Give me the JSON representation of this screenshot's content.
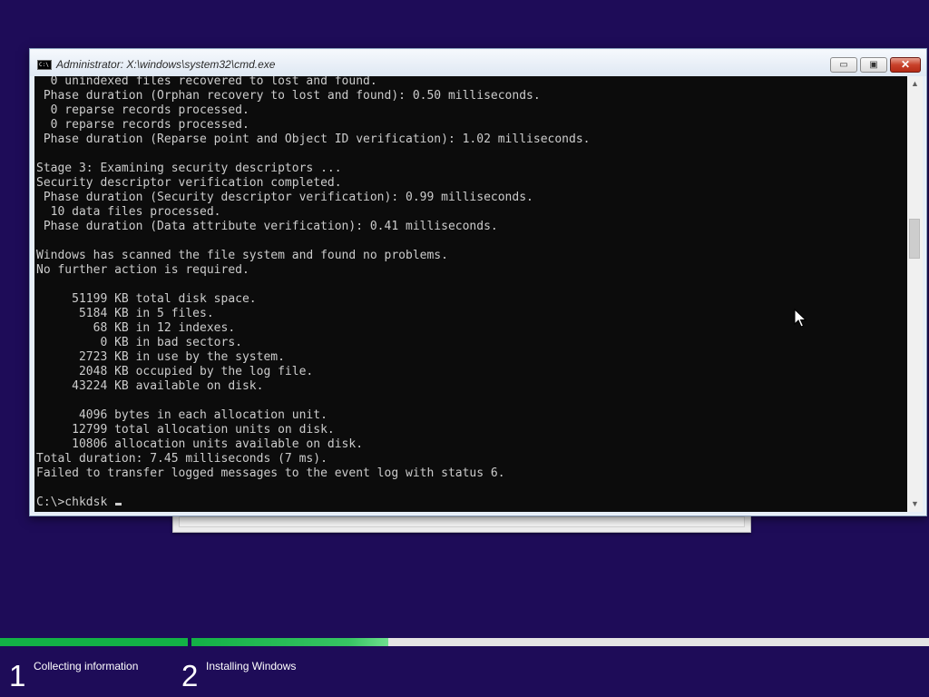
{
  "window": {
    "title": "Administrator: X:\\windows\\system32\\cmd.exe",
    "icon": "console-app-icon",
    "icon_text": "C:\\",
    "minimize_glyph": "▭",
    "maximize_glyph": "▣",
    "close_glyph": "✕"
  },
  "console": {
    "lines": [
      "  0 unindexed files recovered to lost and found.",
      " Phase duration (Orphan recovery to lost and found): 0.50 milliseconds.",
      "  0 reparse records processed.",
      "  0 reparse records processed.",
      " Phase duration (Reparse point and Object ID verification): 1.02 milliseconds.",
      "",
      "Stage 3: Examining security descriptors ...",
      "Security descriptor verification completed.",
      " Phase duration (Security descriptor verification): 0.99 milliseconds.",
      "  10 data files processed.",
      " Phase duration (Data attribute verification): 0.41 milliseconds.",
      "",
      "Windows has scanned the file system and found no problems.",
      "No further action is required.",
      "",
      "     51199 KB total disk space.",
      "      5184 KB in 5 files.",
      "        68 KB in 12 indexes.",
      "         0 KB in bad sectors.",
      "      2723 KB in use by the system.",
      "      2048 KB occupied by the log file.",
      "     43224 KB available on disk.",
      "",
      "      4096 bytes in each allocation unit.",
      "     12799 total allocation units on disk.",
      "     10806 allocation units available on disk.",
      "Total duration: 7.45 milliseconds (7 ms).",
      "Failed to transfer logged messages to the event log with status 6.",
      ""
    ],
    "prompt": "C:\\>chkdsk "
  },
  "scrollbar": {
    "up_glyph": "▲",
    "down_glyph": "▼"
  },
  "setup": {
    "progress_fraction": 0.418,
    "steps": [
      {
        "number": "1",
        "label": "Collecting information"
      },
      {
        "number": "2",
        "label": "Installing Windows"
      }
    ],
    "colors": {
      "background": "#1e0c58",
      "progress": "#13b146",
      "track": "#e4e4e4"
    }
  }
}
